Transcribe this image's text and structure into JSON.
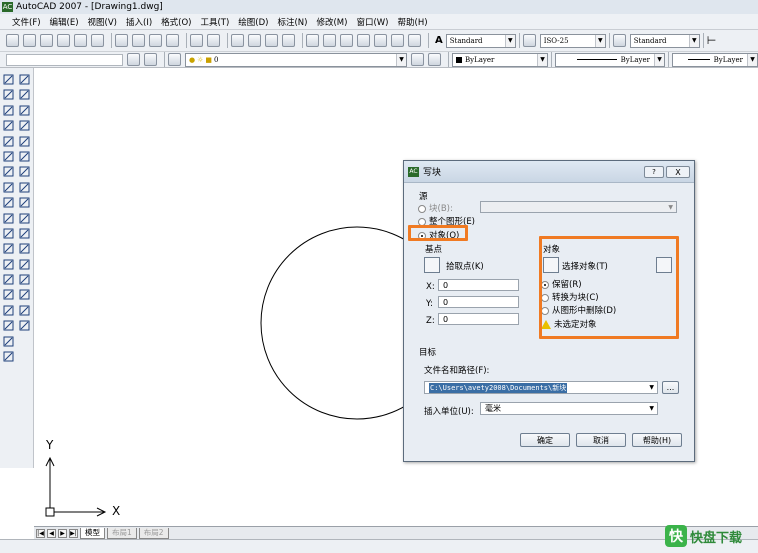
{
  "window": {
    "title": "AutoCAD 2007 - [Drawing1.dwg]",
    "app_icon": "AC"
  },
  "menu": {
    "items": [
      "文件(F)",
      "编辑(E)",
      "视图(V)",
      "插入(I)",
      "格式(O)",
      "工具(T)",
      "绘图(D)",
      "标注(N)",
      "修改(M)",
      "窗口(W)",
      "帮助(H)"
    ]
  },
  "toolbar": {
    "text_style": "Standard",
    "dim_style": "ISO-25",
    "table_style": "Standard",
    "layer": "0",
    "color": "ByLayer",
    "linetype": "ByLayer",
    "lineweight": "ByLayer"
  },
  "layout_tabs": [
    "模型",
    "布局1",
    "布局2"
  ],
  "ucs": {
    "x_label": "X",
    "y_label": "Y"
  },
  "dialog": {
    "title": "写块",
    "icon": "AC",
    "help_btn": "?",
    "close_btn": "X",
    "source_label": "源",
    "opt_block": "块(B):",
    "opt_entire": "整个图形(E)",
    "opt_objects": "对象(O)",
    "basepoint_label": "基点",
    "pick_point": "拾取点(K)",
    "x_label": "X:",
    "y_label": "Y:",
    "z_label": "Z:",
    "x_val": "0",
    "y_val": "0",
    "z_val": "0",
    "objects_label": "对象",
    "select_objects": "选择对象(T)",
    "opt_retain": "保留(R)",
    "opt_convert": "转换为块(C)",
    "opt_delete": "从图形中删除(D)",
    "none_selected": "未选定对象",
    "target_label": "目标",
    "filepath_label": "文件名和路径(F):",
    "filepath_value": "C:\\Users\\avety2008\\Documents\\新块",
    "browse": "...",
    "units_label": "插入单位(U):",
    "units_value": "毫米",
    "ok": "确定",
    "cancel": "取消",
    "help": "帮助(H)"
  },
  "watermark": {
    "text": "快盘下载",
    "logo": "快"
  },
  "colors": {
    "highlight": "#f07a22",
    "dialog_bg": "#e8edf3",
    "titlebar": "#dfe6ee"
  }
}
